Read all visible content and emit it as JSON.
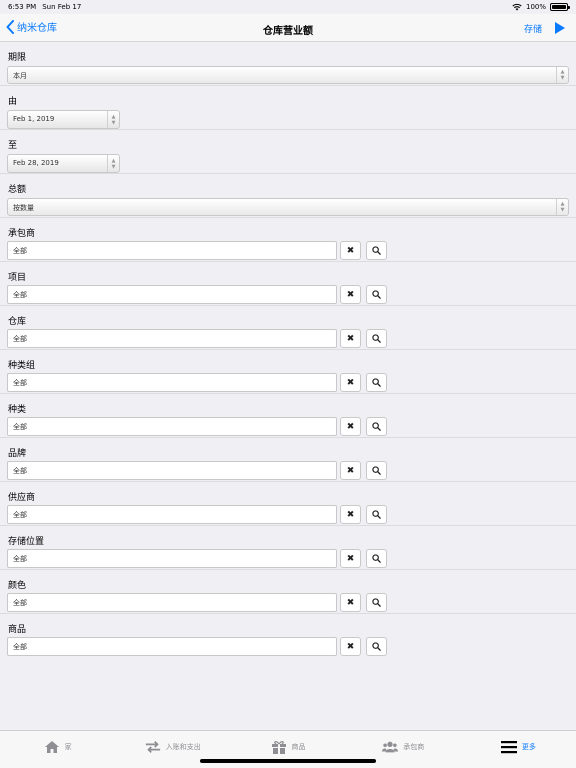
{
  "status_bar": {
    "time": "6:53 PM",
    "date": "Sun Feb 17",
    "battery": "100%"
  },
  "nav": {
    "back_label": "纳米仓库",
    "title": "仓库营业额",
    "save_label": "存储"
  },
  "fields": {
    "period": {
      "label": "期限",
      "value": "本月"
    },
    "from": {
      "label": "由",
      "value": "Feb 1, 2019"
    },
    "to": {
      "label": "至",
      "value": "Feb 28, 2019"
    },
    "total": {
      "label": "总额",
      "value": "按数量"
    },
    "contractor": {
      "label": "承包商",
      "value": "全部"
    },
    "project": {
      "label": "项目",
      "value": "全部"
    },
    "warehouse": {
      "label": "仓库",
      "value": "全部"
    },
    "category_group": {
      "label": "种类组",
      "value": "全部"
    },
    "category": {
      "label": "种类",
      "value": "全部"
    },
    "brand": {
      "label": "品牌",
      "value": "全部"
    },
    "supplier": {
      "label": "供应商",
      "value": "全部"
    },
    "storage_location": {
      "label": "存储位置",
      "value": "全部"
    },
    "color": {
      "label": "颜色",
      "value": "全部"
    },
    "product": {
      "label": "商品",
      "value": "全部"
    }
  },
  "buttons": {
    "clear_glyph": "✖"
  },
  "tabs": [
    {
      "label": "家",
      "icon": "home-icon"
    },
    {
      "label": "入账和支出",
      "icon": "transfer-icon"
    },
    {
      "label": "商品",
      "icon": "gift-icon"
    },
    {
      "label": "承包商",
      "icon": "users-icon"
    },
    {
      "label": "更多",
      "icon": "menu-icon"
    }
  ],
  "colors": {
    "accent": "#0a7aff",
    "inactive": "#8e8e93",
    "background": "#efeff4"
  }
}
